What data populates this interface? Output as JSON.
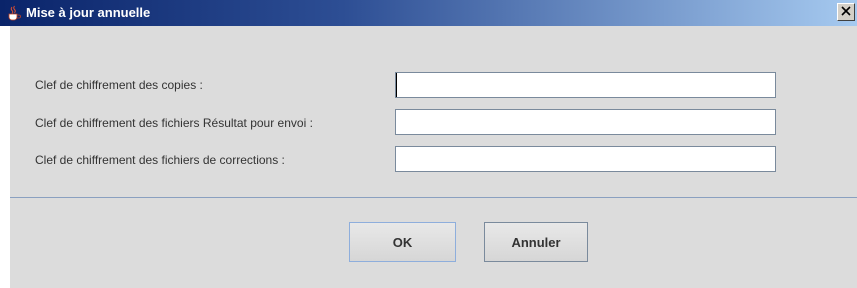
{
  "window": {
    "title": "Mise à jour annuelle"
  },
  "title_bar": {
    "icon": "java-cup-icon",
    "close_icon": "close-icon",
    "gradient_start": "#0a246a",
    "gradient_end": "#a6caf0"
  },
  "form": {
    "fields": [
      {
        "label": "Clef de chiffrement des copies :",
        "value": ""
      },
      {
        "label": "Clef de chiffrement des fichiers Résultat pour envoi :",
        "value": ""
      },
      {
        "label": "Clef de chiffrement des fichiers de corrections :",
        "value": ""
      }
    ]
  },
  "buttons": {
    "ok_label": "OK",
    "cancel_label": "Annuler"
  }
}
